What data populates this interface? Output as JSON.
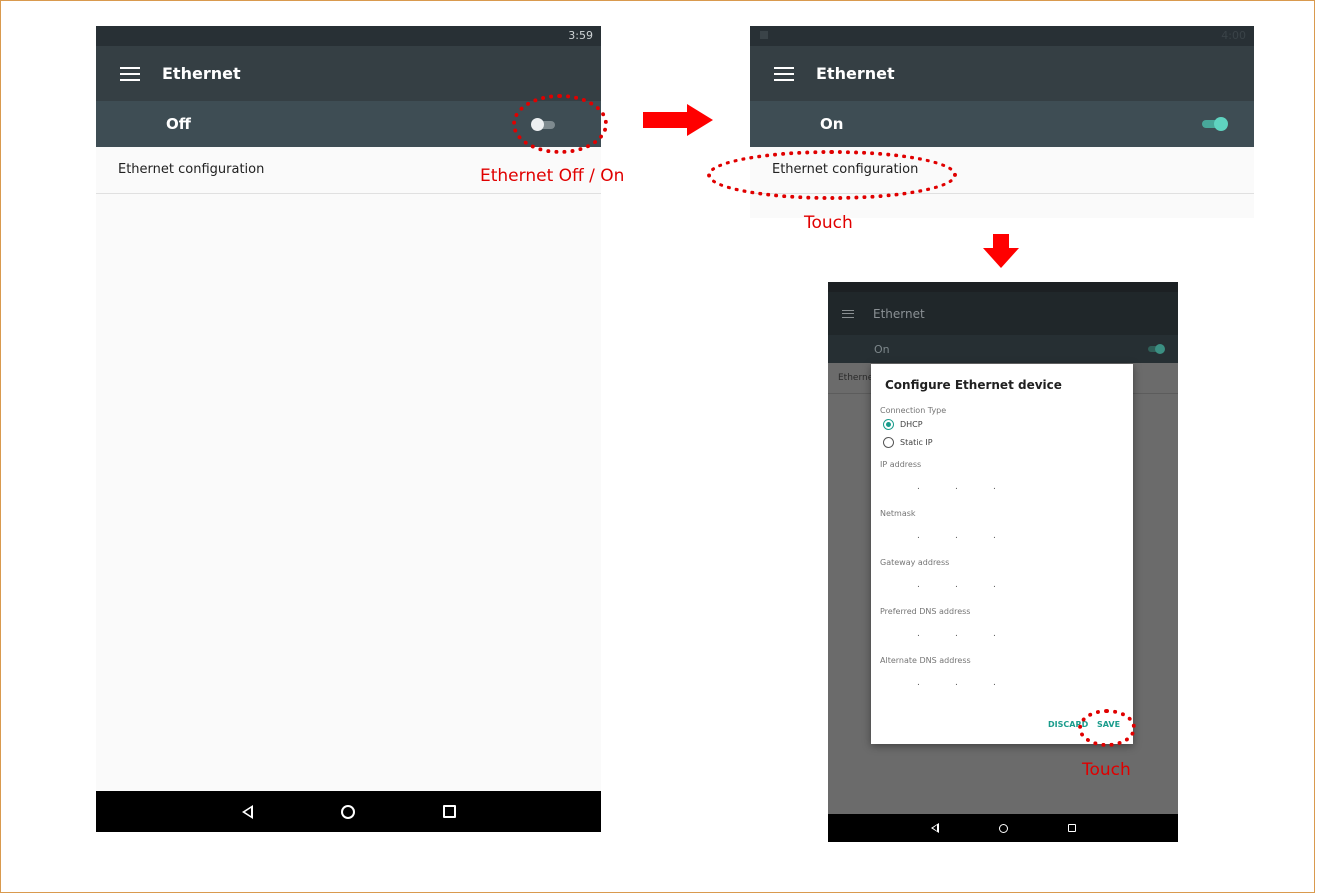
{
  "screen1": {
    "clock": "3:59",
    "title": "Ethernet",
    "switch_label": "Off",
    "item_label": "Ethernet configuration"
  },
  "screen2": {
    "clock": "4:00",
    "title": "Ethernet",
    "switch_label": "On",
    "item_label": "Ethernet configuration"
  },
  "screen3": {
    "title": "Ethernet",
    "switch_label": "On",
    "item_label": "Etherne",
    "dialog": {
      "title": "Configure Ethernet device",
      "connection_type_label": "Connection Type",
      "options": [
        "DHCP",
        "Static IP"
      ],
      "selected_option": "DHCP",
      "fields": [
        "IP address",
        "Netmask",
        "Gateway address",
        "Preferred DNS address",
        "Alternate DNS address"
      ],
      "ip_separator": ".",
      "discard_label": "DISCARD",
      "save_label": "SAVE"
    }
  },
  "annotations": {
    "toggle_caption": "Ethernet Off / On",
    "touch_caption_1": "Touch",
    "touch_caption_2": "Touch"
  },
  "colors": {
    "annotation_red": "#e00000",
    "accent_teal": "#1a9c8c",
    "appbar": "#353f44"
  }
}
